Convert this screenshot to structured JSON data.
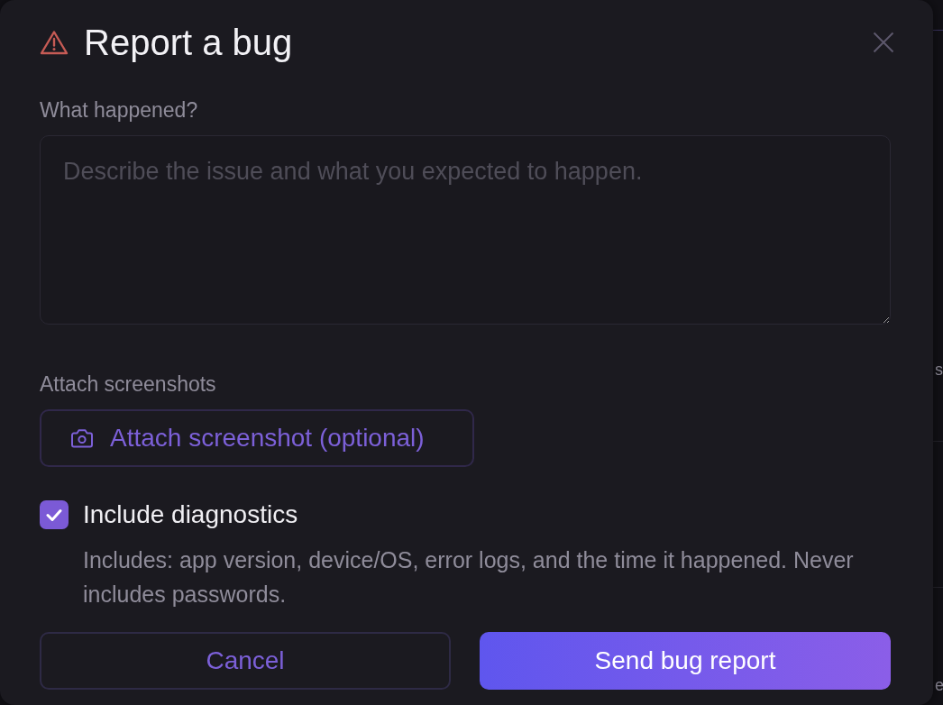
{
  "dialog": {
    "title": "Report a bug"
  },
  "description": {
    "label": "What happened?",
    "placeholder": "Describe the issue and what you expected to happen."
  },
  "attachments": {
    "label": "Attach screenshots",
    "button": "Attach screenshot (optional)"
  },
  "diagnostics": {
    "label": "Include diagnostics",
    "checked": true,
    "help": "Includes: app version, device/OS, error logs, and the time it happened. Never includes passwords."
  },
  "buttons": [
    {
      "label": "Cancel",
      "kind": "secondary"
    },
    {
      "label": "Send bug report",
      "kind": "primary"
    }
  ],
  "background_fragments": [
    "s",
    "e"
  ]
}
